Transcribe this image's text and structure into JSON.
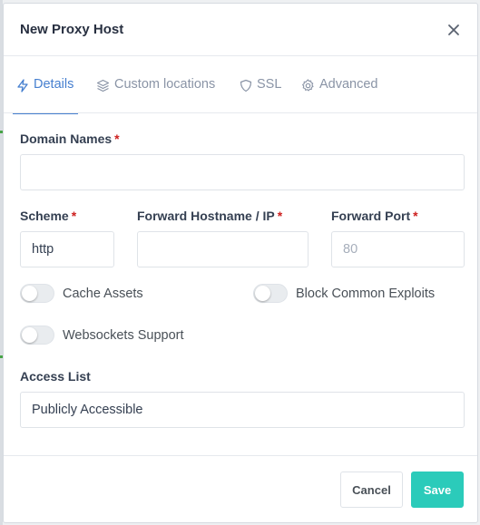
{
  "modal": {
    "title": "New Proxy Host",
    "close_icon": "close-icon"
  },
  "tabs": [
    {
      "label": "Details",
      "icon": "bolt-icon",
      "active": true
    },
    {
      "label": "Custom locations",
      "icon": "layers-icon",
      "active": false
    },
    {
      "label": "SSL",
      "icon": "shield-icon",
      "active": false
    },
    {
      "label": "Advanced",
      "icon": "gear-icon",
      "active": false
    }
  ],
  "form": {
    "domain_names": {
      "label": "Domain Names",
      "required_mark": "*",
      "value": "",
      "placeholder": ""
    },
    "scheme": {
      "label": "Scheme",
      "required_mark": "*",
      "value": "http"
    },
    "forward_hostname": {
      "label": "Forward Hostname / IP",
      "required_mark": "*",
      "value": "",
      "placeholder": ""
    },
    "forward_port": {
      "label": "Forward Port",
      "required_mark": "*",
      "value": "",
      "placeholder": "80"
    },
    "toggles": {
      "cache_assets": {
        "label": "Cache Assets",
        "on": false
      },
      "block_exploits": {
        "label": "Block Common Exploits",
        "on": false
      },
      "websockets": {
        "label": "Websockets Support",
        "on": false
      }
    },
    "access_list": {
      "label": "Access List",
      "value": "Publicly Accessible"
    }
  },
  "footer": {
    "cancel_label": "Cancel",
    "save_label": "Save"
  },
  "colors": {
    "accent": "#467fcf",
    "save": "#2bcbba",
    "required": "#cd201f"
  }
}
